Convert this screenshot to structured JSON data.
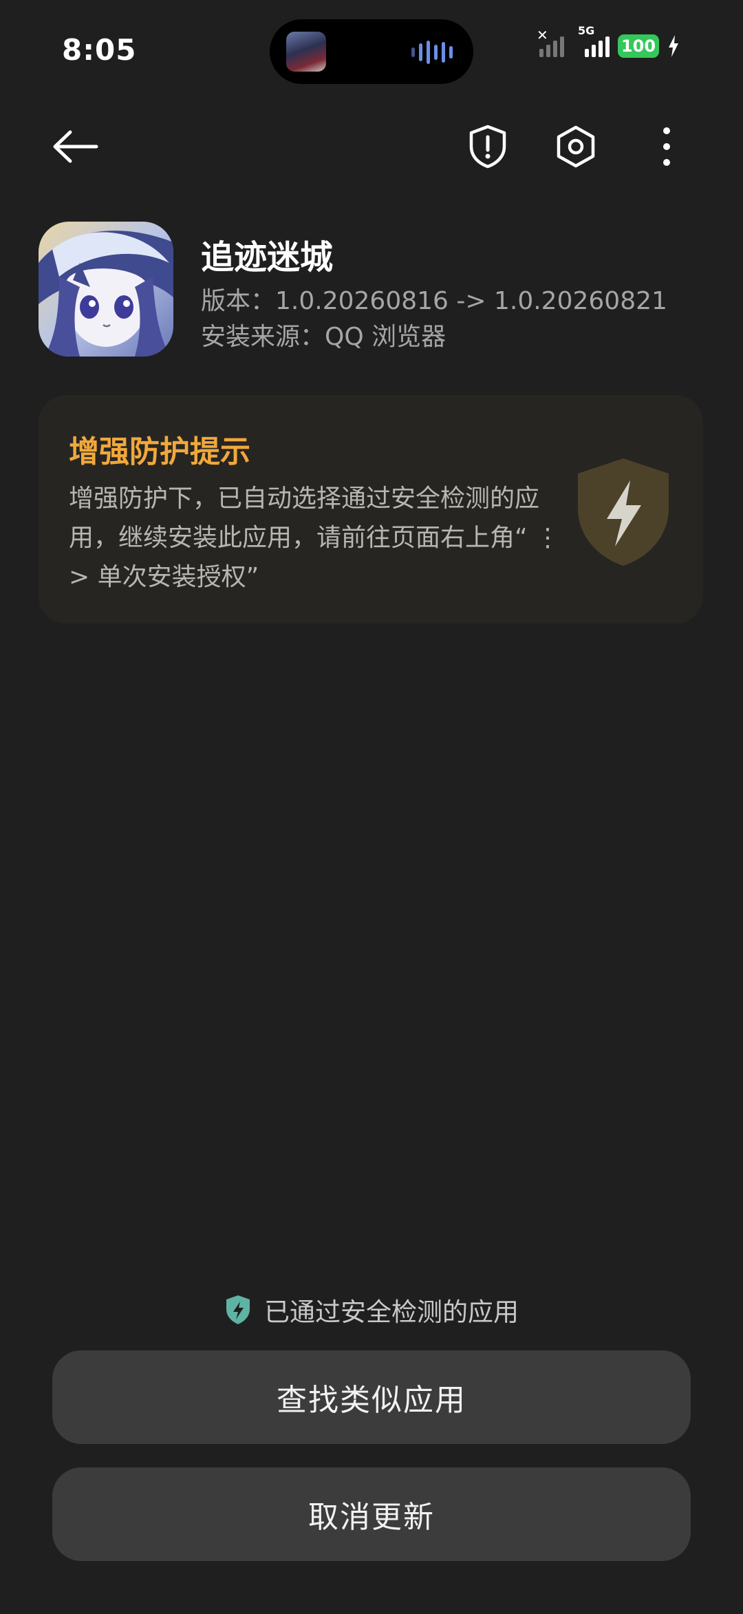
{
  "status_bar": {
    "time": "8:05",
    "network": "5G",
    "battery": "100"
  },
  "toolbar": {
    "back_icon": "arrow-left-icon",
    "shield_icon": "shield-alert-icon",
    "settings_icon": "hexagon-gear-icon",
    "more_icon": "more-vertical-icon"
  },
  "app": {
    "name": "追迹迷城",
    "version": "版本：1.0.20260816 -> 1.0.20260821",
    "source": "安装来源：QQ 浏览器"
  },
  "notice": {
    "title": "增强防护提示",
    "body": "增强防护下，已自动选择通过安全检测的应用，继续安装此应用，请前往页面右上角“ ⋮ > 单次安装授权”",
    "icon": "lightning-shield-icon"
  },
  "footer": {
    "verified_text": "已通过安全检测的应用",
    "find_similar_label": "查找类似应用",
    "cancel_update_label": "取消更新"
  },
  "colors": {
    "background": "#1f1f1f",
    "accent_orange": "#f0a83c",
    "battery_green": "#34c759",
    "verified_teal": "#5fb3a3",
    "button_bg": "#3c3c3c"
  }
}
